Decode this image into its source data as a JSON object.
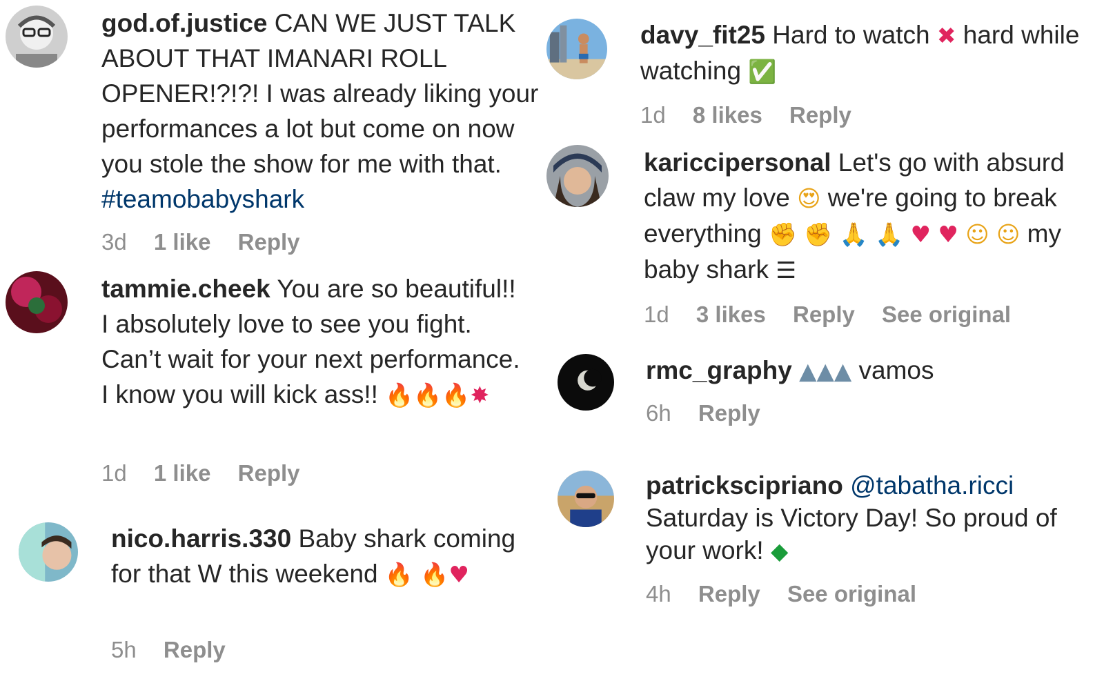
{
  "comments": [
    {
      "username": "god.of.justice",
      "text": "CAN WE JUST TALK ABOUT THAT IMANARI ROLL OPENER!?!?! I was already liking your performances a lot but come on now you stole the show for me with that.",
      "hashtag": "#teamobabyshark",
      "age": "3d",
      "likes": "1 like",
      "reply": "Reply"
    },
    {
      "username": "tammie.cheek",
      "text": "You are so beautiful!! I absolutely love to see you fight. Can’t wait for your next performance. I know you will kick ass!!",
      "age": "1d",
      "likes": "1 like",
      "reply": "Reply"
    },
    {
      "username": "nico.harris.330",
      "text": "Baby shark coming for that W this weekend",
      "age": "5h",
      "reply": "Reply"
    },
    {
      "username": "davy_fit25",
      "text_a": "Hard to watch",
      "text_b": "hard while watching",
      "age": "1d",
      "likes": "8 likes",
      "reply": "Reply"
    },
    {
      "username": "karicci personal",
      "username_display": "kariccipersonal",
      "text_a": "Let's go with absurd claw my love",
      "text_b": "we're going to break everything",
      "text_c": "my baby shark",
      "age": "1d",
      "likes": "3 likes",
      "reply": "Reply",
      "see_original": "See original"
    },
    {
      "username": "rmc_graphy",
      "text": "vamos",
      "age": "6h",
      "reply": "Reply"
    },
    {
      "username": "patrickscipriano",
      "mention": "@tabatha.ricci",
      "text": "Saturday is Victory Day! So proud of your work!",
      "age": "4h",
      "reply": "Reply",
      "see_original": "See original"
    }
  ]
}
